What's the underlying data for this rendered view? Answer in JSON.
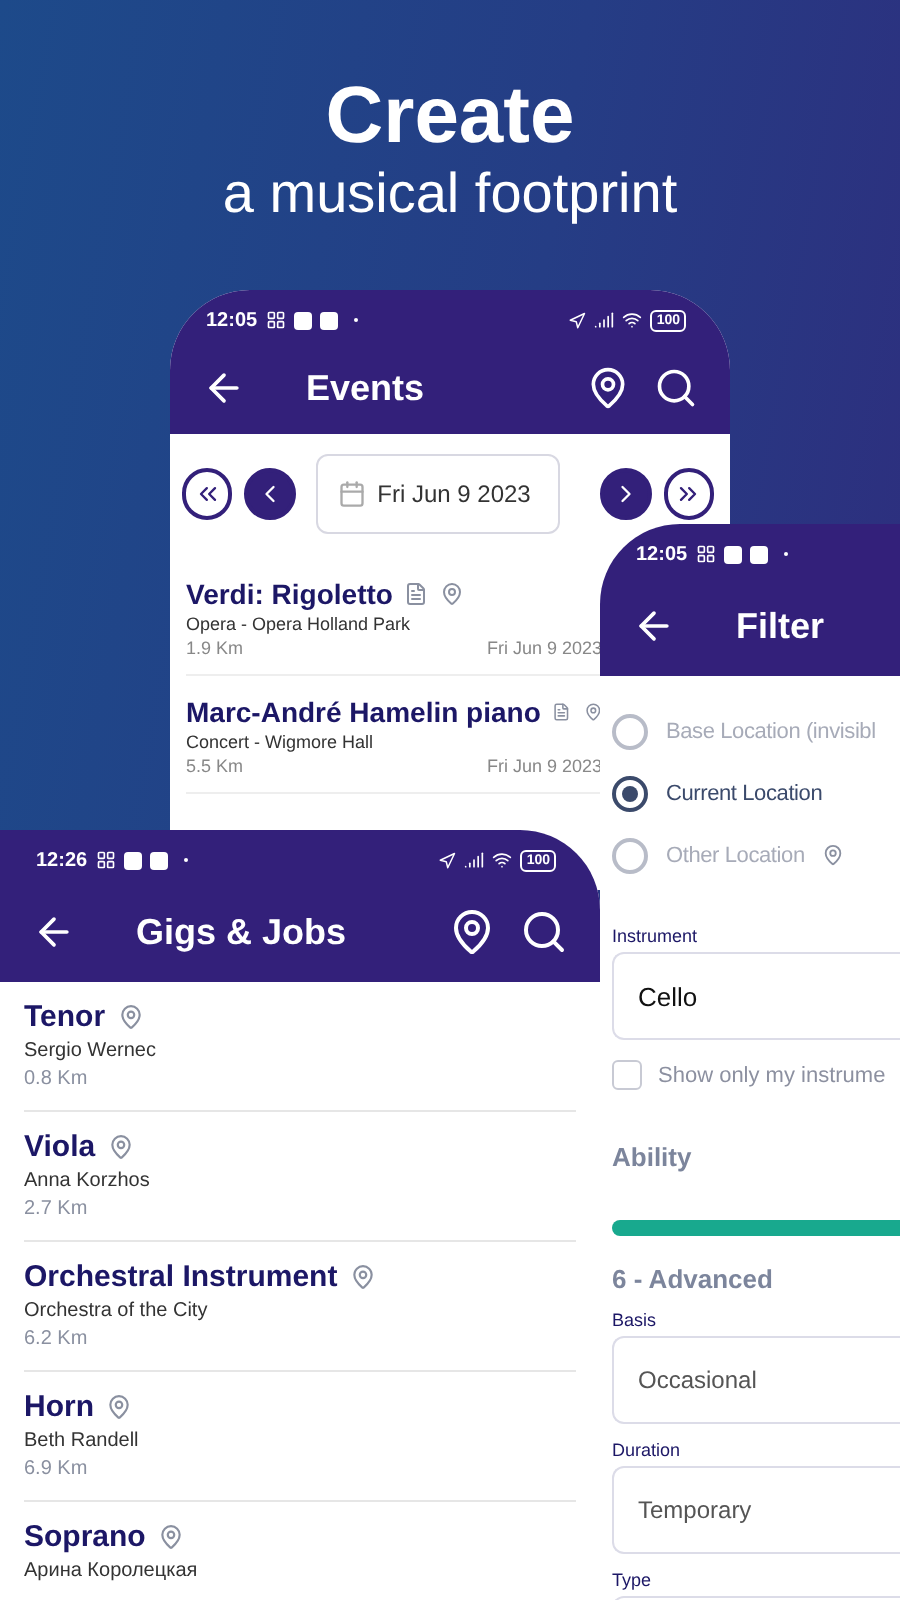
{
  "headline": {
    "title": "Create",
    "subtitle": "a musical footprint"
  },
  "events_screen": {
    "status_time": "12:05",
    "battery": "100",
    "title": "Events",
    "date": "Fri Jun 9 2023",
    "events": [
      {
        "title": "Verdi: Rigoletto",
        "venue": "Opera - Opera Holland Park",
        "distance": "1.9 Km",
        "date": "Fri Jun 9 2023"
      },
      {
        "title": "Marc-André Hamelin piano",
        "venue": "Concert - Wigmore Hall",
        "distance": "5.5 Km",
        "date": "Fri Jun 9 2023"
      }
    ]
  },
  "filter_screen": {
    "status_time": "12:05",
    "title": "Filter",
    "locations": [
      {
        "label": "Base Location (invisibl",
        "selected": false,
        "has_pin": false
      },
      {
        "label": "Current Location",
        "selected": true,
        "has_pin": false
      },
      {
        "label": "Other Location",
        "selected": false,
        "has_pin": true
      }
    ],
    "instrument": {
      "label": "Instrument",
      "value": "Cello"
    },
    "only_my_instrument": {
      "label": "Show only my instrume",
      "checked": false
    },
    "ability": {
      "heading": "Ability",
      "level": 1,
      "value": "6 - Advanced"
    },
    "fields": [
      {
        "label": "Basis",
        "value": "Occasional"
      },
      {
        "label": "Duration",
        "value": "Temporary"
      },
      {
        "label": "Type"
      }
    ]
  },
  "gigs_screen": {
    "status_time": "12:26",
    "battery": "100",
    "title": "Gigs & Jobs",
    "gigs": [
      {
        "title": "Tenor",
        "subtitle": "Sergio Wernec",
        "distance": "0.8 Km"
      },
      {
        "title": "Viola",
        "subtitle": "Anna Korzhos",
        "distance": "2.7 Km"
      },
      {
        "title": "Orchestral Instrument",
        "subtitle": "Orchestra of the City",
        "distance": "6.2 Km"
      },
      {
        "title": "Horn",
        "subtitle": "Beth Randell",
        "distance": "6.9 Km"
      },
      {
        "title": "Soprano",
        "subtitle": "Арина Королецкая"
      }
    ]
  }
}
